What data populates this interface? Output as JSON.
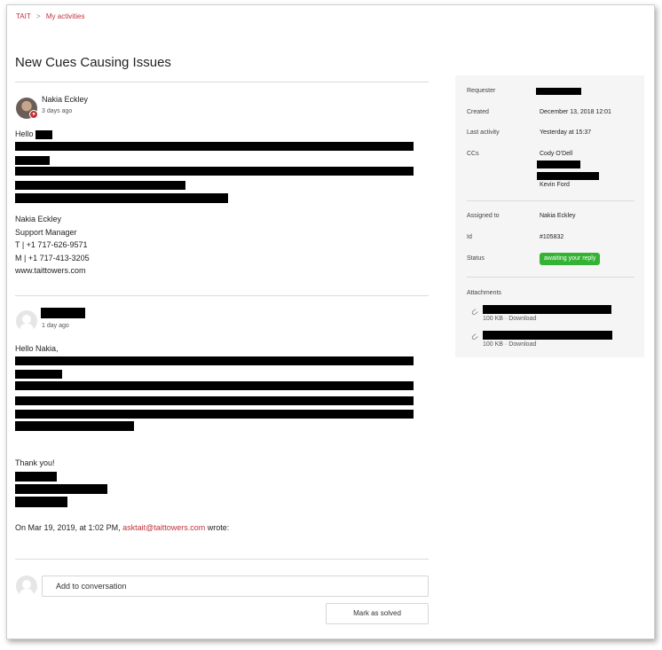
{
  "breadcrumb": {
    "root": "TAIT",
    "separator": ">",
    "current": "My activities"
  },
  "request": {
    "title": "New Cues Causing Issues"
  },
  "comments": [
    {
      "author": "Nakia Eckley",
      "time": "3 days ago",
      "greeting": "Hello",
      "signature": {
        "name": "Nakia Eckley",
        "role": "Support Manager",
        "phone_t": "T  | +1 717-626-9571",
        "phone_m": "M | +1 717-413-3205",
        "website": "www.taittowers.com"
      }
    },
    {
      "author": "",
      "time": "1 day ago",
      "greeting": "Hello Nakia,",
      "thanks": "Thank you!",
      "quote_prefix": "On Mar 19, 2019, at 1:02 PM,",
      "quote_email": "asktait@taittowers.com",
      "quote_suffix": "wrote:"
    }
  ],
  "reply": {
    "placeholder": "Add to conversation",
    "mark_solved_label": "Mark as solved"
  },
  "sidebar": {
    "requester_label": "Requester",
    "created_label": "Created",
    "created_value": "December 13, 2018 12:01",
    "last_activity_label": "Last activity",
    "last_activity_value": "Yesterday at 15:37",
    "ccs_label": "CCs",
    "ccs": [
      "Cody O'Dell",
      "Kevin Ford"
    ],
    "assigned_label": "Assigned to",
    "assigned_value": "Nakia Eckley",
    "id_label": "Id",
    "id_value": "#105832",
    "status_label": "Status",
    "status_value": "awaiting your reply",
    "attachments_label": "Attachments",
    "attachments": [
      {
        "size": "100 KB",
        "sep": "·",
        "action": "Download"
      },
      {
        "size": "100 KB",
        "sep": "·",
        "action": "Download"
      }
    ]
  },
  "colors": {
    "accent": "#c0323a",
    "status_green": "#34b233",
    "sidebar_bg": "#f5f5f5"
  },
  "icons": [
    "avatar",
    "paperclip-icon"
  ]
}
